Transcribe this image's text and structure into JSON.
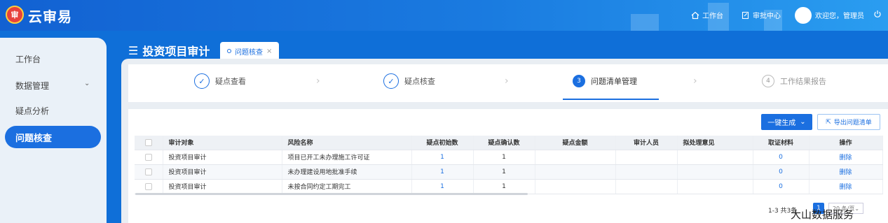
{
  "app": {
    "logo_text": "审",
    "title": "云审易"
  },
  "topnav": {
    "workbench": "工作台",
    "approval": "审批中心",
    "welcome": "欢迎您，管理员"
  },
  "icons": {
    "home": "home-icon",
    "approval": "document-icon",
    "power": "power-icon",
    "menu": "list-icon"
  },
  "sidebar": {
    "items": [
      {
        "label": "工作台"
      },
      {
        "label": "数据管理"
      },
      {
        "label": "疑点分析"
      },
      {
        "label": "问题核查"
      }
    ]
  },
  "page": {
    "title": "投资项目审计",
    "tab_label": "问题核查"
  },
  "steps": [
    {
      "label": "疑点查看",
      "num": "✓",
      "state": "done"
    },
    {
      "label": "疑点核查",
      "num": "✓",
      "state": "done"
    },
    {
      "label": "问题清单管理",
      "num": "3",
      "state": "active"
    },
    {
      "label": "工作结果报告",
      "num": "4",
      "state": "todo"
    }
  ],
  "toolbar": {
    "generate": "一键生成",
    "export": "导出问题清单"
  },
  "table": {
    "headers": [
      "审计对象",
      "风险名称",
      "疑点初始数",
      "疑点确认数",
      "疑点金额",
      "审计人员",
      "拟处理意见",
      "取证材料",
      "操作"
    ],
    "rows": [
      {
        "object": "投资项目审计",
        "risk": "项目已开工未办理施工许可证",
        "init": "1",
        "confirm": "1",
        "amount": "",
        "auditor": "",
        "opinion": "",
        "evidence": "0",
        "action": "删除"
      },
      {
        "object": "投资项目审计",
        "risk": "未办理建设用地批准手续",
        "init": "1",
        "confirm": "1",
        "amount": "",
        "auditor": "",
        "opinion": "",
        "evidence": "0",
        "action": "删除"
      },
      {
        "object": "投资项目审计",
        "risk": "未按合同约定工期完工",
        "init": "1",
        "confirm": "1",
        "amount": "",
        "auditor": "",
        "opinion": "",
        "evidence": "0",
        "action": "删除"
      }
    ]
  },
  "pager": {
    "total": "1-3 共3条",
    "current": "1",
    "size": "20 条/页"
  },
  "watermark": "大山数据服务",
  "colors": {
    "primary": "#1b6fe0",
    "header_bg": "#1261d2",
    "danger_logo": "#e8413c"
  }
}
